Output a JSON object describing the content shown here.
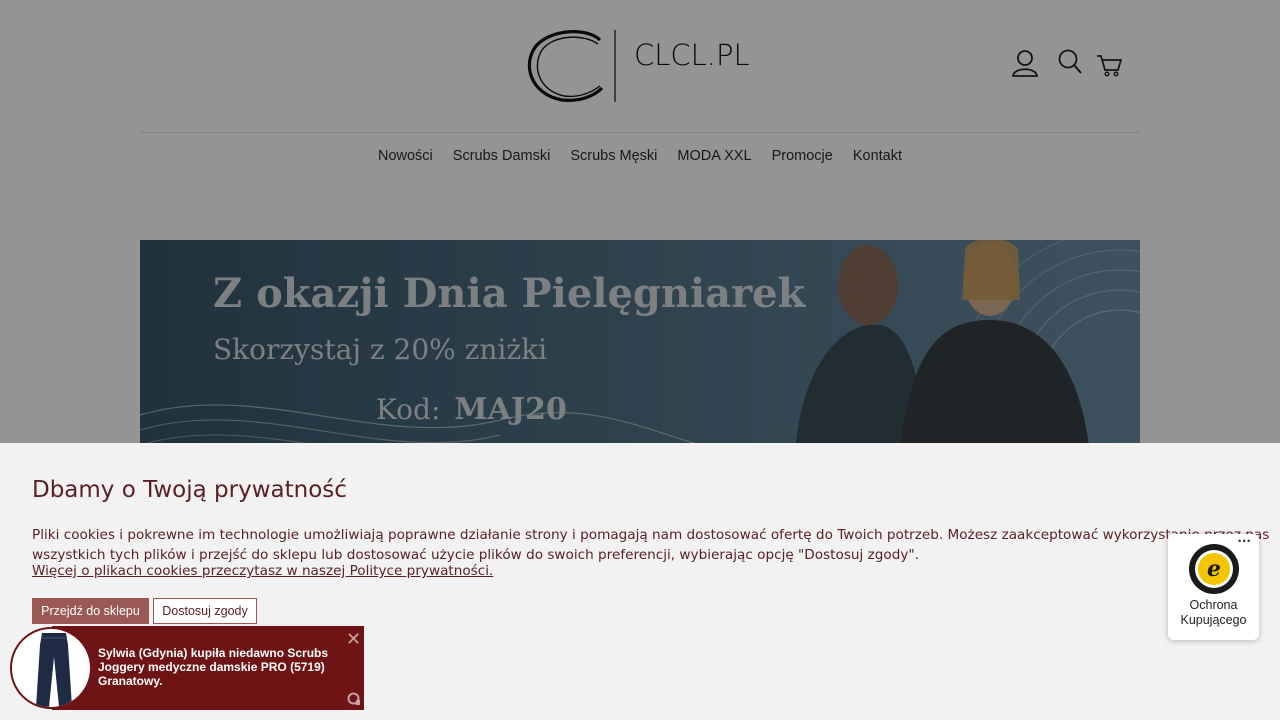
{
  "logo": {
    "text": "CLCL.PL"
  },
  "header": {
    "icons": [
      "user-icon",
      "search-icon",
      "cart-icon"
    ]
  },
  "nav": {
    "items": [
      "Nowości",
      "Scrubs Damski",
      "Scrubs Męski",
      "MODA XXL",
      "Promocje",
      "Kontakt"
    ]
  },
  "banner": {
    "line1": "Z okazji Dnia Pielęgniarek",
    "line2": "Skorzystaj z 20% zniżki",
    "code_label": "Kod:",
    "code": "MAJ20"
  },
  "cookie": {
    "title": "Dbamy o Twoją prywatność",
    "body_line1": "Pliki cookies i pokrewne im technologie umożliwiają poprawne działanie strony i pomagają nam dostosować ofertę do Twoich potrzeb. Możesz zaakceptować wykorzystanie przez nas",
    "body_line2": "wszystkich tych plików i przejść do sklepu lub dostosować użycie plików do swoich preferencji, wybierając opcję \"Dostosuj zgody\".",
    "link": "Więcej o plikach cookies przeczytasz w naszej Polityce prywatności.",
    "accept_label": "Przejdź do sklepu",
    "customize_label": "Dostosuj zgody"
  },
  "trusted_shops": {
    "menu": "···",
    "label_line1": "Ochrona",
    "label_line2": "Kupującego"
  },
  "notification": {
    "text": "Sylwia (Gdynia) kupiła niedawno Scrubs Joggery medyczne damskie PRO (5719) Granatowy.",
    "close": "✕"
  },
  "colors": {
    "accent": "#9a5a53",
    "cookie_text": "#5a2124",
    "notification_bg": "#6e1414",
    "banner_bg": "#4a6b80"
  }
}
